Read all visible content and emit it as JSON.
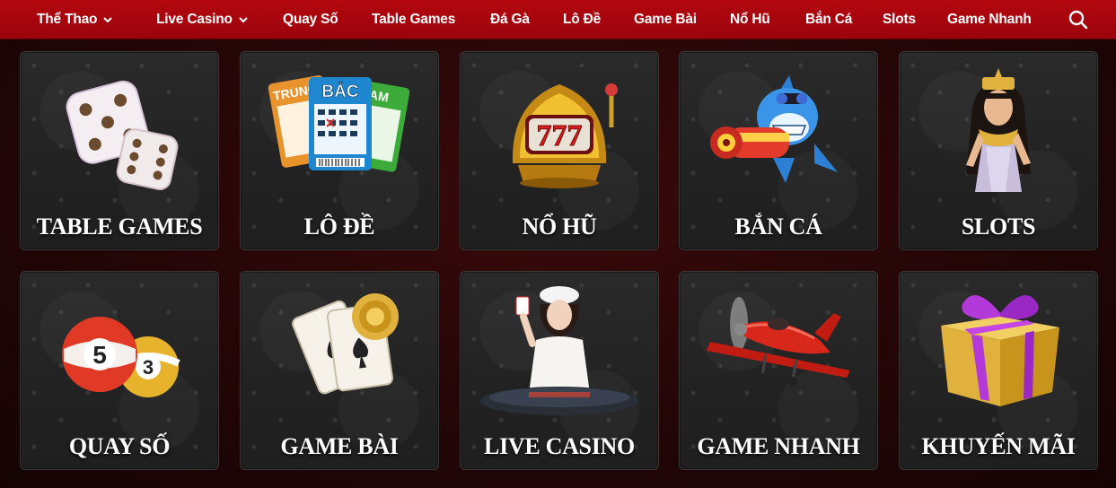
{
  "nav": {
    "items": [
      {
        "label": "Thể Thao",
        "dropdown": true
      },
      {
        "label": "Live Casino",
        "dropdown": true
      },
      {
        "label": "Quay Số"
      },
      {
        "label": "Table Games"
      },
      {
        "label": "Đá Gà"
      },
      {
        "label": "Lô Đề"
      },
      {
        "label": "Game Bài"
      },
      {
        "label": "Nổ Hũ"
      },
      {
        "label": "Bắn Cá"
      },
      {
        "label": "Slots"
      },
      {
        "label": "Game Nhanh"
      }
    ],
    "search_icon": "search-icon",
    "bar_color": "#b3060f"
  },
  "cards": [
    {
      "label": "TABLE GAMES",
      "icon": "dice-icon"
    },
    {
      "label": "LÔ ĐỀ",
      "icon": "lottery-tickets-icon",
      "ticket_labels": [
        "TRUNG",
        "BẮC",
        "NAM"
      ]
    },
    {
      "label": "NỔ HŨ",
      "icon": "slot-machine-icon",
      "reel_text": "777"
    },
    {
      "label": "BẮN CÁ",
      "icon": "shark-icon"
    },
    {
      "label": "SLOTS",
      "icon": "cleopatra-icon"
    },
    {
      "label": "QUAY SỐ",
      "icon": "lottery-balls-icon",
      "ball_numbers": [
        "5",
        "3"
      ]
    },
    {
      "label": "GAME BÀI",
      "icon": "playing-cards-icon"
    },
    {
      "label": "LIVE CASINO",
      "icon": "dealer-icon"
    },
    {
      "label": "GAME NHANH",
      "icon": "airplane-icon"
    },
    {
      "label": "KHUYẾN MÃI",
      "icon": "gift-box-icon"
    }
  ]
}
